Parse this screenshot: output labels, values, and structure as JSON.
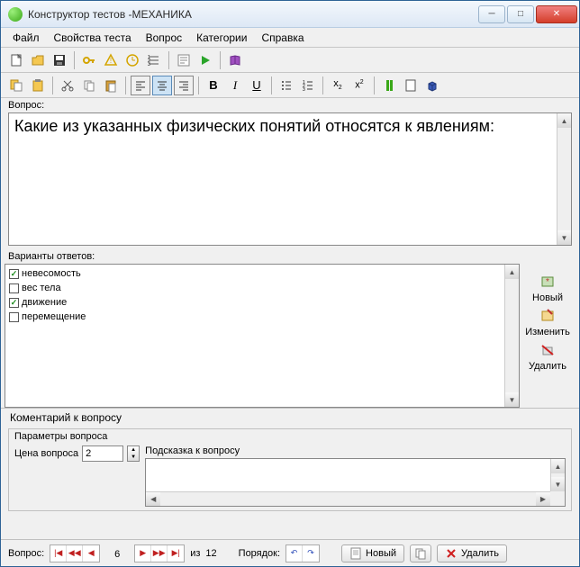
{
  "window": {
    "title": "Конструктор тестов -МЕХАНИКА"
  },
  "menu": {
    "items": [
      "Файл",
      "Свойства теста",
      "Вопрос",
      "Категории",
      "Справка"
    ]
  },
  "question": {
    "label": "Вопрос:",
    "text": "Какие из указанных физических понятий относятся к явлениям:"
  },
  "answers": {
    "label": "Варианты ответов:",
    "items": [
      {
        "text": "невесомость",
        "checked": true
      },
      {
        "text": "вес тела",
        "checked": false
      },
      {
        "text": "движение",
        "checked": true
      },
      {
        "text": "перемещение",
        "checked": false
      }
    ],
    "side": {
      "new": "Новый",
      "edit": "Изменить",
      "delete": "Удалить"
    }
  },
  "comment": {
    "label": "Коментарий к вопросу"
  },
  "params": {
    "header": "Параметры вопроса",
    "price_label": "Цена вопроса",
    "price_value": "2",
    "hint_label": "Подсказка к вопросу"
  },
  "status": {
    "label": "Вопрос:",
    "current": "6",
    "of": "из",
    "total": "12",
    "order": "Порядок:",
    "new": "Новый",
    "delete": "Удалить"
  }
}
